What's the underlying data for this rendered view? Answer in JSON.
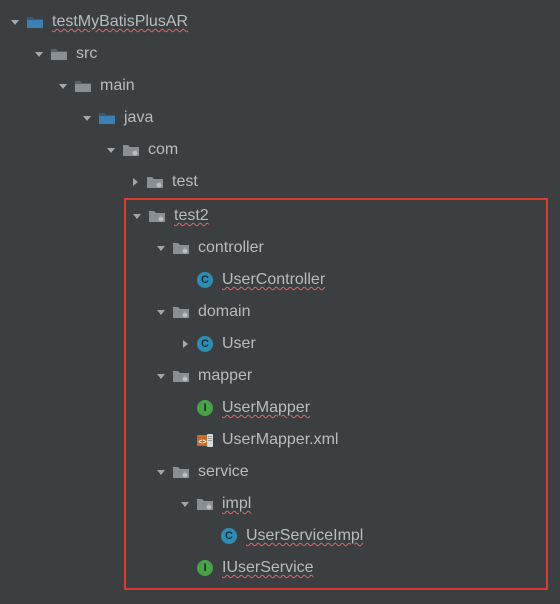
{
  "root": {
    "label": "testMyBatisPlusAR"
  },
  "src": {
    "label": "src"
  },
  "main": {
    "label": "main"
  },
  "java": {
    "label": "java"
  },
  "com": {
    "label": "com"
  },
  "test": {
    "label": "test"
  },
  "test2": {
    "label": "test2"
  },
  "controller": {
    "label": "controller"
  },
  "userController": {
    "label": "UserController"
  },
  "domain": {
    "label": "domain"
  },
  "user": {
    "label": "User"
  },
  "mapper": {
    "label": "mapper"
  },
  "userMapper": {
    "label": "UserMapper"
  },
  "userMapperXml": {
    "label": "UserMapper.xml"
  },
  "service": {
    "label": "service"
  },
  "impl": {
    "label": "impl"
  },
  "userServiceImpl": {
    "label": "UserServiceImpl"
  },
  "iUserService": {
    "label": "IUserService"
  }
}
